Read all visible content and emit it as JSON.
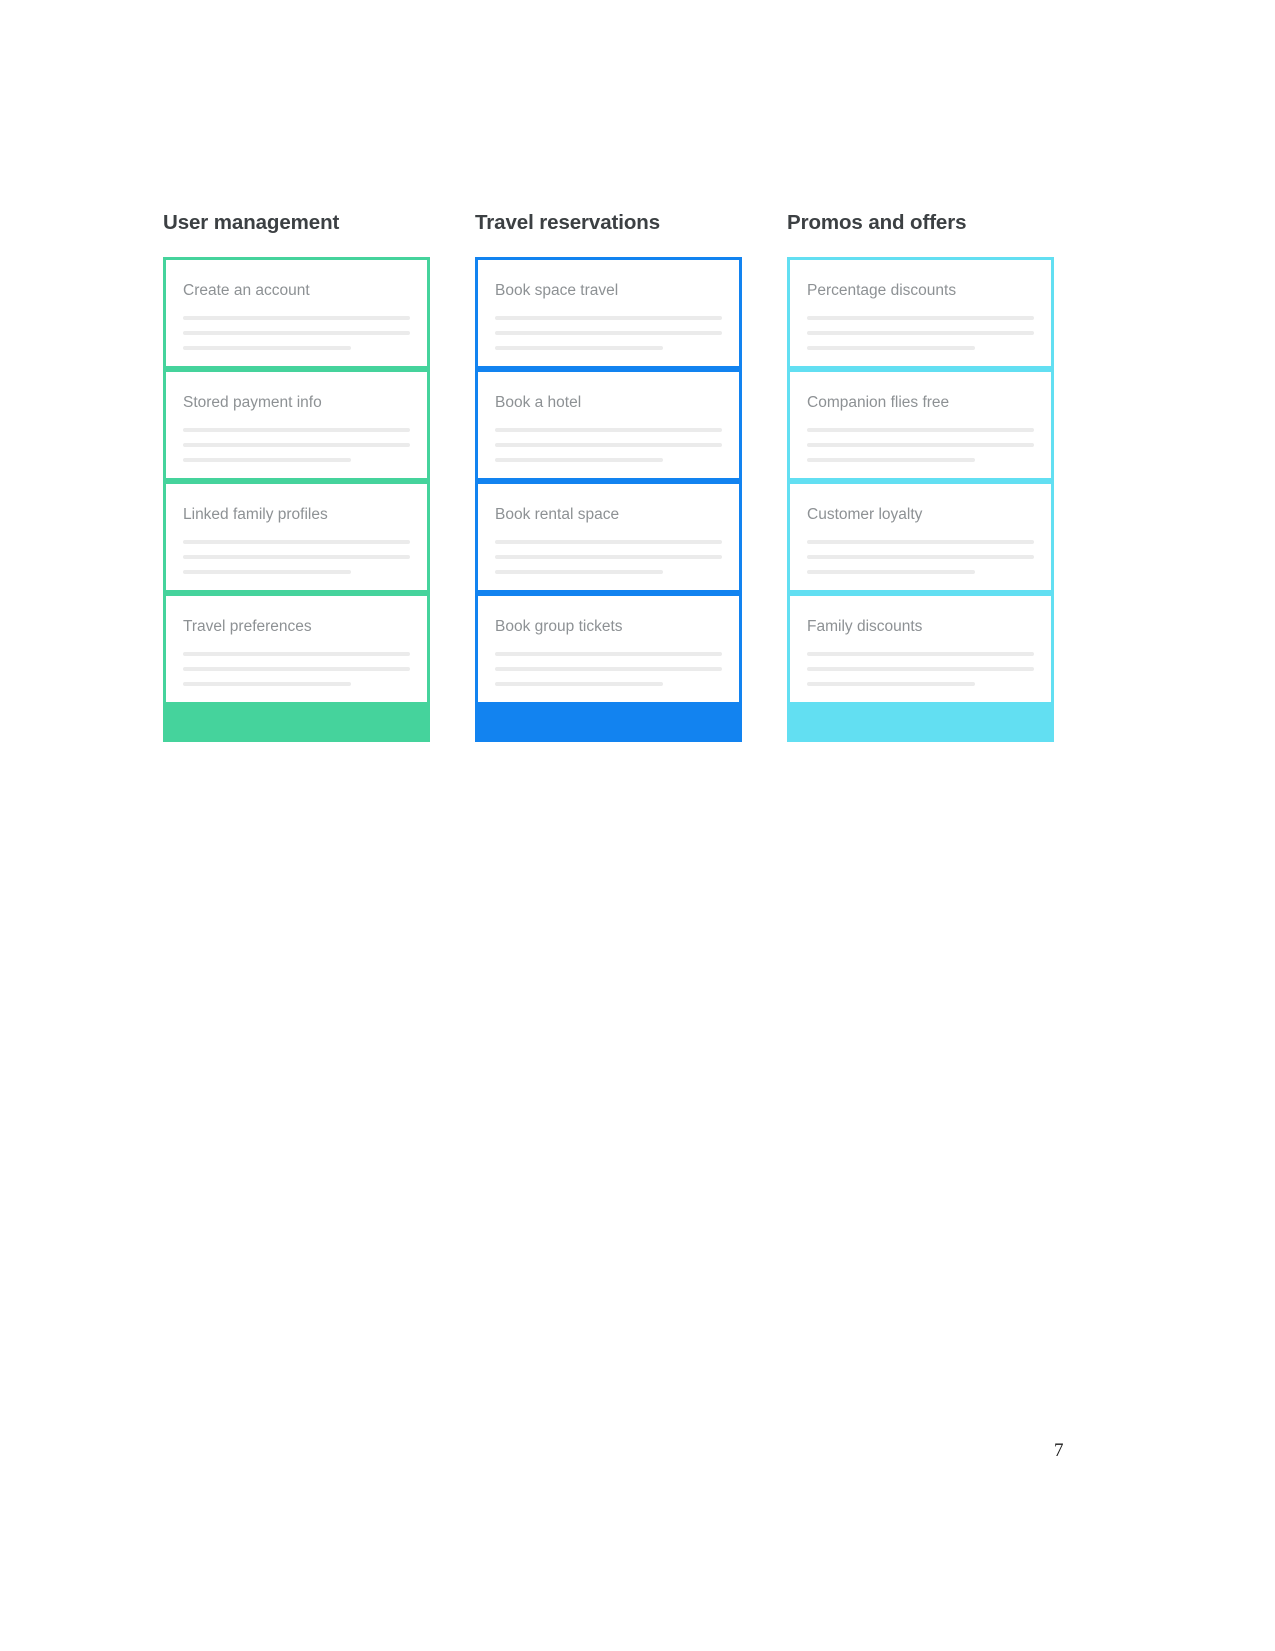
{
  "page": {
    "number": "7",
    "background_color": "#ffffff"
  },
  "board": {
    "columns": [
      {
        "id": "user-management",
        "header": "User management",
        "accent_color": "#45d39c",
        "cards": [
          {
            "title": "Create an account",
            "lines": 3
          },
          {
            "title": "Stored payment info",
            "lines": 3
          },
          {
            "title": "Linked family profiles",
            "lines": 3
          },
          {
            "title": "Travel preferences",
            "lines": 3
          }
        ]
      },
      {
        "id": "travel-reservations",
        "header": "Travel reservations",
        "accent_color": "#1283f0",
        "cards": [
          {
            "title": "Book space travel",
            "lines": 3
          },
          {
            "title": "Book a hotel",
            "lines": 3
          },
          {
            "title": "Book rental space",
            "lines": 3
          },
          {
            "title": "Book group tickets",
            "lines": 3
          }
        ]
      },
      {
        "id": "promos-and-offers",
        "header": "Promos and offers",
        "accent_color": "#62dff2",
        "cards": [
          {
            "title": "Percentage discounts",
            "lines": 3
          },
          {
            "title": "Companion flies free",
            "lines": 3
          },
          {
            "title": "Customer loyalty",
            "lines": 3
          },
          {
            "title": "Family discounts",
            "lines": 3
          }
        ]
      }
    ]
  }
}
